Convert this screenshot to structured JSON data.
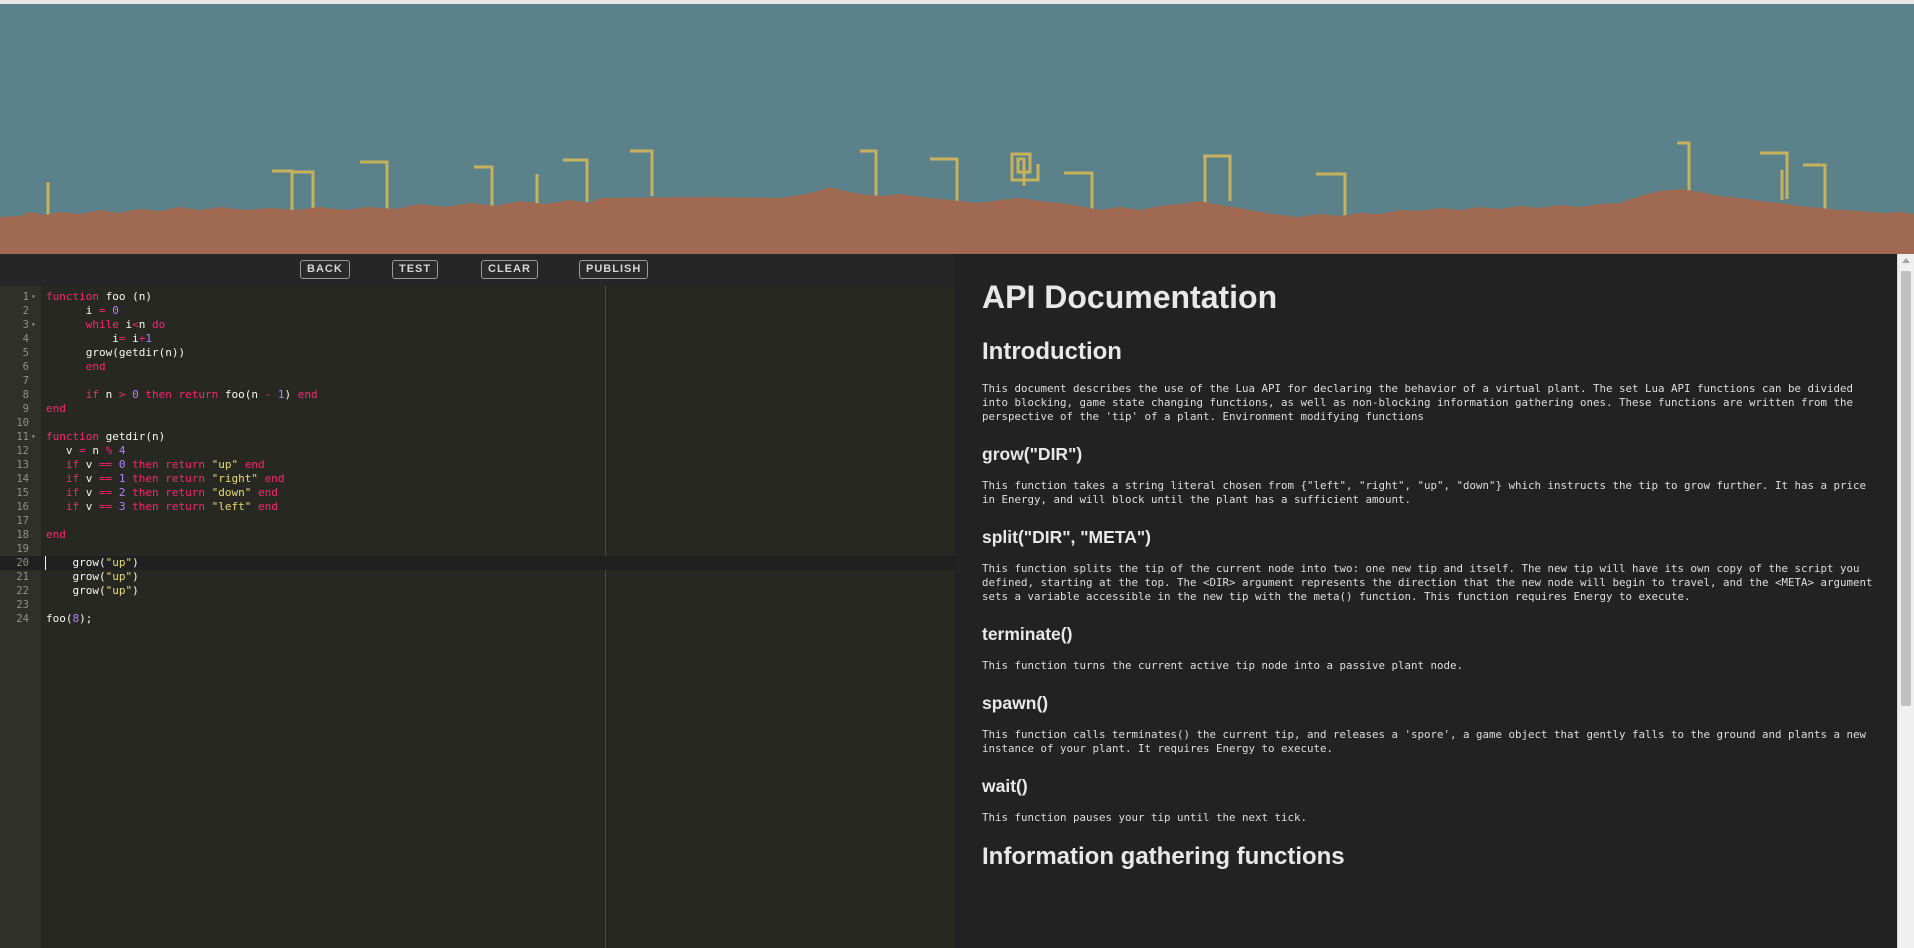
{
  "toolbar": {
    "back_label": "BACK",
    "test_label": "TEST",
    "clear_label": "CLEAR",
    "publish_label": "PUBLISH"
  },
  "editor": {
    "lines": [
      {
        "n": "1",
        "fold": "▾",
        "tokens": [
          {
            "t": "kw",
            "v": "function"
          },
          {
            "t": "txt",
            "v": " foo (n)"
          }
        ]
      },
      {
        "n": "2",
        "fold": "",
        "tokens": [
          {
            "t": "txt",
            "v": "      i "
          },
          {
            "t": "kw",
            "v": "="
          },
          {
            "t": "txt",
            "v": " "
          },
          {
            "t": "num",
            "v": "0"
          }
        ]
      },
      {
        "n": "3",
        "fold": "▾",
        "tokens": [
          {
            "t": "txt",
            "v": "      "
          },
          {
            "t": "kw",
            "v": "while"
          },
          {
            "t": "txt",
            "v": " i"
          },
          {
            "t": "kw",
            "v": "<"
          },
          {
            "t": "txt",
            "v": "n "
          },
          {
            "t": "kw",
            "v": "do"
          }
        ]
      },
      {
        "n": "4",
        "fold": "",
        "tokens": [
          {
            "t": "txt",
            "v": "          i"
          },
          {
            "t": "kw",
            "v": "="
          },
          {
            "t": "txt",
            "v": " i"
          },
          {
            "t": "kw",
            "v": "+"
          },
          {
            "t": "num",
            "v": "1"
          }
        ]
      },
      {
        "n": "5",
        "fold": "",
        "tokens": [
          {
            "t": "txt",
            "v": "      grow(getdir(n))"
          }
        ]
      },
      {
        "n": "6",
        "fold": "",
        "tokens": [
          {
            "t": "txt",
            "v": "      "
          },
          {
            "t": "kw",
            "v": "end"
          }
        ]
      },
      {
        "n": "7",
        "fold": "",
        "tokens": [
          {
            "t": "txt",
            "v": ""
          }
        ]
      },
      {
        "n": "8",
        "fold": "",
        "tokens": [
          {
            "t": "txt",
            "v": "      "
          },
          {
            "t": "kw",
            "v": "if"
          },
          {
            "t": "txt",
            "v": " n "
          },
          {
            "t": "kw",
            "v": ">"
          },
          {
            "t": "txt",
            "v": " "
          },
          {
            "t": "num",
            "v": "0"
          },
          {
            "t": "txt",
            "v": " "
          },
          {
            "t": "kw",
            "v": "then"
          },
          {
            "t": "txt",
            "v": " "
          },
          {
            "t": "kw",
            "v": "return"
          },
          {
            "t": "txt",
            "v": " foo(n "
          },
          {
            "t": "kw",
            "v": "-"
          },
          {
            "t": "txt",
            "v": " "
          },
          {
            "t": "num",
            "v": "1"
          },
          {
            "t": "txt",
            "v": ") "
          },
          {
            "t": "kw",
            "v": "end"
          }
        ]
      },
      {
        "n": "9",
        "fold": "",
        "tokens": [
          {
            "t": "kw",
            "v": "end"
          }
        ]
      },
      {
        "n": "10",
        "fold": "",
        "tokens": [
          {
            "t": "txt",
            "v": ""
          }
        ]
      },
      {
        "n": "11",
        "fold": "▾",
        "tokens": [
          {
            "t": "kw",
            "v": "function"
          },
          {
            "t": "txt",
            "v": " getdir(n)"
          }
        ]
      },
      {
        "n": "12",
        "fold": "",
        "tokens": [
          {
            "t": "txt",
            "v": "   v "
          },
          {
            "t": "kw",
            "v": "="
          },
          {
            "t": "txt",
            "v": " n "
          },
          {
            "t": "kw",
            "v": "%"
          },
          {
            "t": "txt",
            "v": " "
          },
          {
            "t": "num",
            "v": "4"
          }
        ]
      },
      {
        "n": "13",
        "fold": "",
        "tokens": [
          {
            "t": "txt",
            "v": "   "
          },
          {
            "t": "kw",
            "v": "if"
          },
          {
            "t": "txt",
            "v": " v "
          },
          {
            "t": "kw",
            "v": "=="
          },
          {
            "t": "txt",
            "v": " "
          },
          {
            "t": "num",
            "v": "0"
          },
          {
            "t": "txt",
            "v": " "
          },
          {
            "t": "kw",
            "v": "then"
          },
          {
            "t": "txt",
            "v": " "
          },
          {
            "t": "kw",
            "v": "return"
          },
          {
            "t": "txt",
            "v": " "
          },
          {
            "t": "str",
            "v": "\"up\""
          },
          {
            "t": "txt",
            "v": " "
          },
          {
            "t": "kw",
            "v": "end"
          }
        ]
      },
      {
        "n": "14",
        "fold": "",
        "tokens": [
          {
            "t": "txt",
            "v": "   "
          },
          {
            "t": "kw",
            "v": "if"
          },
          {
            "t": "txt",
            "v": " v "
          },
          {
            "t": "kw",
            "v": "=="
          },
          {
            "t": "txt",
            "v": " "
          },
          {
            "t": "num",
            "v": "1"
          },
          {
            "t": "txt",
            "v": " "
          },
          {
            "t": "kw",
            "v": "then"
          },
          {
            "t": "txt",
            "v": " "
          },
          {
            "t": "kw",
            "v": "return"
          },
          {
            "t": "txt",
            "v": " "
          },
          {
            "t": "str",
            "v": "\"right\""
          },
          {
            "t": "txt",
            "v": " "
          },
          {
            "t": "kw",
            "v": "end"
          }
        ]
      },
      {
        "n": "15",
        "fold": "",
        "tokens": [
          {
            "t": "txt",
            "v": "   "
          },
          {
            "t": "kw",
            "v": "if"
          },
          {
            "t": "txt",
            "v": " v "
          },
          {
            "t": "kw",
            "v": "=="
          },
          {
            "t": "txt",
            "v": " "
          },
          {
            "t": "num",
            "v": "2"
          },
          {
            "t": "txt",
            "v": " "
          },
          {
            "t": "kw",
            "v": "then"
          },
          {
            "t": "txt",
            "v": " "
          },
          {
            "t": "kw",
            "v": "return"
          },
          {
            "t": "txt",
            "v": " "
          },
          {
            "t": "str",
            "v": "\"down\""
          },
          {
            "t": "txt",
            "v": " "
          },
          {
            "t": "kw",
            "v": "end"
          }
        ]
      },
      {
        "n": "16",
        "fold": "",
        "tokens": [
          {
            "t": "txt",
            "v": "   "
          },
          {
            "t": "kw",
            "v": "if"
          },
          {
            "t": "txt",
            "v": " v "
          },
          {
            "t": "kw",
            "v": "=="
          },
          {
            "t": "txt",
            "v": " "
          },
          {
            "t": "num",
            "v": "3"
          },
          {
            "t": "txt",
            "v": " "
          },
          {
            "t": "kw",
            "v": "then"
          },
          {
            "t": "txt",
            "v": " "
          },
          {
            "t": "kw",
            "v": "return"
          },
          {
            "t": "txt",
            "v": " "
          },
          {
            "t": "str",
            "v": "\"left\""
          },
          {
            "t": "txt",
            "v": " "
          },
          {
            "t": "kw",
            "v": "end"
          }
        ]
      },
      {
        "n": "17",
        "fold": "",
        "tokens": [
          {
            "t": "txt",
            "v": ""
          }
        ]
      },
      {
        "n": "18",
        "fold": "",
        "tokens": [
          {
            "t": "kw",
            "v": "end"
          }
        ]
      },
      {
        "n": "19",
        "fold": "",
        "tokens": [
          {
            "t": "txt",
            "v": ""
          }
        ]
      },
      {
        "n": "20",
        "fold": "",
        "active": true,
        "tokens": [
          {
            "t": "txt",
            "v": "    grow("
          },
          {
            "t": "str",
            "v": "\"up\""
          },
          {
            "t": "txt",
            "v": ")"
          }
        ]
      },
      {
        "n": "21",
        "fold": "",
        "tokens": [
          {
            "t": "txt",
            "v": "    grow("
          },
          {
            "t": "str",
            "v": "\"up\""
          },
          {
            "t": "txt",
            "v": ")"
          }
        ]
      },
      {
        "n": "22",
        "fold": "",
        "tokens": [
          {
            "t": "txt",
            "v": "    grow("
          },
          {
            "t": "str",
            "v": "\"up\""
          },
          {
            "t": "txt",
            "v": ")"
          }
        ]
      },
      {
        "n": "23",
        "fold": "",
        "tokens": [
          {
            "t": "txt",
            "v": ""
          }
        ]
      },
      {
        "n": "24",
        "fold": "",
        "tokens": [
          {
            "t": "txt",
            "v": "foo("
          },
          {
            "t": "num",
            "v": "8"
          },
          {
            "t": "txt",
            "v": ");"
          }
        ]
      }
    ]
  },
  "docs": {
    "title": "API Documentation",
    "intro_heading": "Introduction",
    "intro_text": "This document describes the use of the Lua API for declaring the behavior of a virtual plant. The set Lua API functions can be divided into blocking, game state changing functions, as well as non-blocking information gathering ones. These functions are written from the perspective of the 'tip' of a plant. Environment modifying functions",
    "functions": [
      {
        "name": "grow(\"DIR\")",
        "desc": "This function takes a string literal chosen from {\"left\", \"right\", \"up\", \"down\"} which instructs the tip to grow further. It has a price in Energy, and will block until the plant has a sufficient amount."
      },
      {
        "name": "split(\"DIR\", \"META\")",
        "desc": "This function splits the tip of the current node into two: one new tip and itself. The new tip will have its own copy of the script you defined, starting at the top. The <DIR> argument represents the direction that the new node will begin to travel, and the <META> argument sets a variable accessible in the new tip with the meta() function. This function requires Energy to execute."
      },
      {
        "name": "terminate()",
        "desc": "This function turns the current active tip node into a passive plant node."
      },
      {
        "name": "spawn()",
        "desc": "This function calls terminates() the current tip, and releases a 'spore', a game object that gently falls to the ground and plants a new instance of your plant. It requires Energy to execute."
      },
      {
        "name": "wait()",
        "desc": "This function pauses your tip until the next tick."
      }
    ],
    "info_heading": "Information gathering functions"
  },
  "colors": {
    "sky": "#5b828a",
    "ground": "#a06a52",
    "plant": "#c8b15e",
    "editor_bg": "#272822",
    "keyword": "#f92672",
    "number": "#ae81ff",
    "string": "#e6db74"
  }
}
